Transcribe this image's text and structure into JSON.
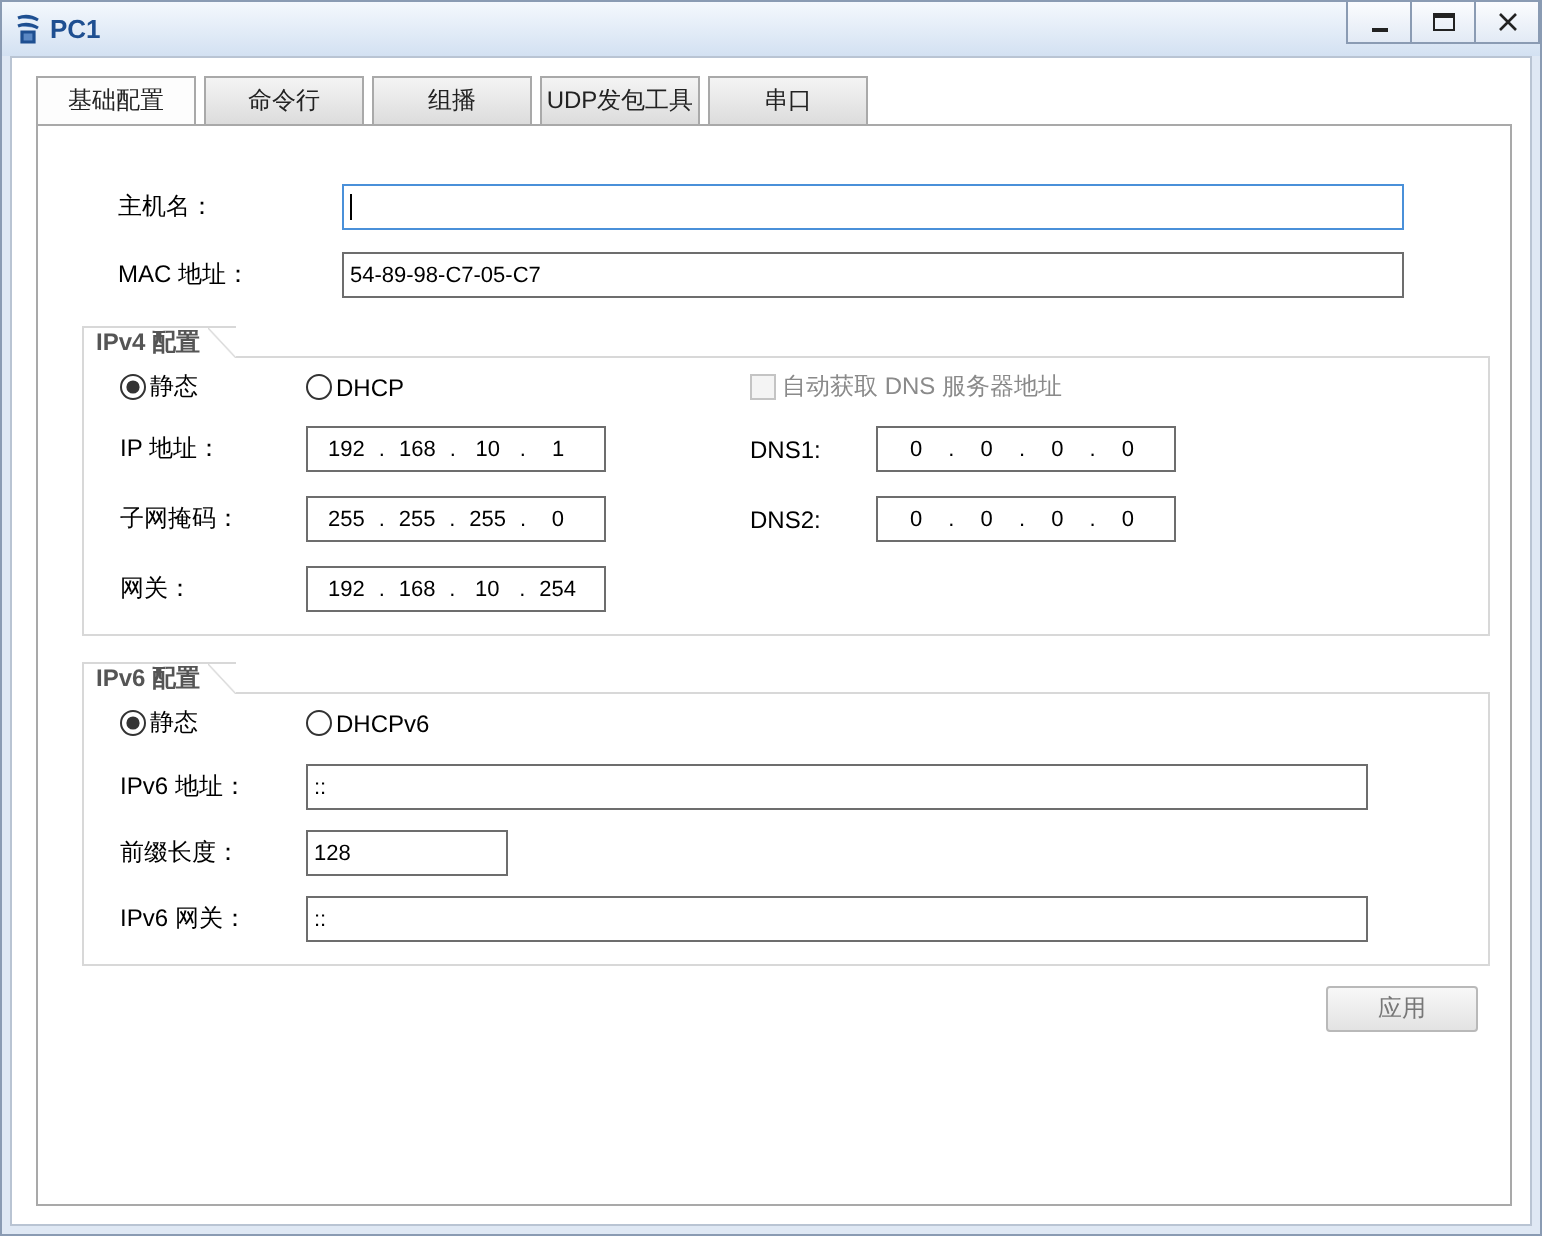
{
  "window": {
    "title": "PC1"
  },
  "tabs": [
    {
      "label": "基础配置",
      "selected": true
    },
    {
      "label": "命令行",
      "selected": false
    },
    {
      "label": "组播",
      "selected": false
    },
    {
      "label": "UDP发包工具",
      "selected": false
    },
    {
      "label": "串口",
      "selected": false
    }
  ],
  "host": {
    "label": "主机名：",
    "focused": true
  },
  "mac": {
    "label": "MAC 地址：",
    "value": "54-89-98-C7-05-C7",
    "focused": false
  },
  "ipv4": {
    "title": "IPv4 配置",
    "modes": [
      {
        "label": "静态",
        "selected": true
      },
      {
        "label": "DHCP",
        "selected": false
      }
    ],
    "auto_dns": {
      "label": "自动获取 DNS 服务器地址",
      "checked": false,
      "disabled": true
    },
    "rows": [
      {
        "label": "IP 地址：",
        "octets": [
          "192",
          "168",
          "10",
          "1"
        ],
        "dns_label": "DNS1:",
        "dns_octets": [
          "0",
          "0",
          "0",
          "0"
        ]
      },
      {
        "label": "子网掩码：",
        "octets": [
          "255",
          "255",
          "255",
          "0"
        ],
        "dns_label": "DNS2:",
        "dns_octets": [
          "0",
          "0",
          "0",
          "0"
        ]
      },
      {
        "label": "网关：",
        "octets": [
          "192",
          "168",
          "10",
          "254"
        ]
      }
    ],
    "separator": "."
  },
  "ipv6": {
    "title": "IPv6 配置",
    "modes": [
      {
        "label": "静态",
        "selected": true
      },
      {
        "label": "DHCPv6",
        "selected": false
      }
    ],
    "address": {
      "label": "IPv6 地址：",
      "value": "::"
    },
    "prefix": {
      "label": "前缀长度：",
      "value": "128"
    },
    "gateway": {
      "label": "IPv6 网关：",
      "value": "::"
    }
  },
  "apply_button": "应用"
}
